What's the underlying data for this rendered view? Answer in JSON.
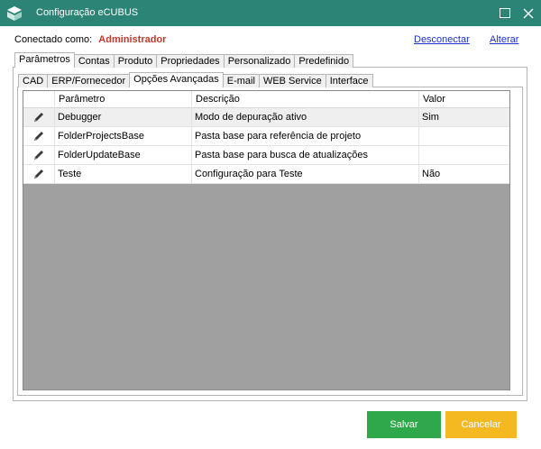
{
  "window": {
    "title": "Configuração eCUBUS",
    "icons": {
      "app": "ecubus-logo-icon",
      "maximize": "maximize-icon",
      "close": "close-icon"
    }
  },
  "connection": {
    "label": "Conectado como:",
    "user": "Administrador",
    "disconnect_link": "Desconectar",
    "alter_link": "Alterar"
  },
  "outer_tabs": [
    "Parâmetros",
    "Contas",
    "Produto",
    "Propriedades",
    "Personalizado",
    "Predefinido"
  ],
  "inner_tabs": [
    "CAD",
    "ERP/Fornecedor",
    "Opções Avançadas",
    "E-mail",
    "WEB Service",
    "Interface"
  ],
  "grid": {
    "columns": [
      "",
      "Parâmetro",
      "Descrição",
      "Valor"
    ],
    "rows": [
      {
        "param": "Debugger",
        "desc": "Modo de depuração ativo",
        "value": "Sim",
        "icon": "edit-pencil-icon"
      },
      {
        "param": "FolderProjectsBase",
        "desc": "Pasta base para referência de projeto",
        "value": "",
        "icon": "edit-pencil-icon"
      },
      {
        "param": "FolderUpdateBase",
        "desc": "Pasta base para busca de atualizações",
        "value": "",
        "icon": "edit-pencil-icon"
      },
      {
        "param": "Teste",
        "desc": "Configuração para Teste",
        "value": "Não",
        "icon": "edit-pencil-icon"
      }
    ]
  },
  "buttons": {
    "save": "Salvar",
    "cancel": "Cancelar"
  },
  "colors": {
    "titlebar": "#2b8475",
    "save": "#2ea84a",
    "cancel": "#f4b920",
    "user": "#c0392b",
    "link": "#1a2fd4"
  }
}
